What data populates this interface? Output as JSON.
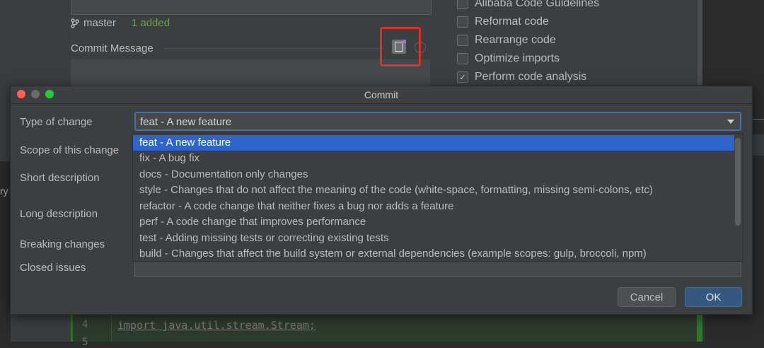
{
  "background": {
    "branch": "master",
    "added": "1 added",
    "commit_message_label": "Commit Message",
    "options": [
      {
        "label": "Alibaba Code Guidelines",
        "checked": false
      },
      {
        "label": "Reformat code",
        "checked": false
      },
      {
        "label": "Rearrange code",
        "checked": false
      },
      {
        "label": "Optimize imports",
        "checked": false
      },
      {
        "label": "Perform code analysis",
        "checked": true
      }
    ],
    "check_mark": "✓",
    "code_line_number": "4",
    "code_line_number_next": "5",
    "code_line": "import java.util.stream.Stream;",
    "left_edge_text": "ry"
  },
  "dialog": {
    "title": "Commit",
    "fields": {
      "type_of_change": "Type of change",
      "scope": "Scope of this change",
      "short_description": "Short description",
      "long_description": "Long description",
      "breaking_changes": "Breaking changes",
      "closed_issues": "Closed issues"
    },
    "selected_type": "feat - A new feature",
    "dropdown_items": [
      "feat - A new feature",
      "fix - A bug fix",
      "docs - Documentation only changes",
      "style - Changes that do not affect the meaning of the code (white-space, formatting, missing semi-colons, etc)",
      "refactor - A code change that neither fixes a bug nor adds a feature",
      "perf - A code change that improves performance",
      "test - Adding missing tests or correcting existing tests",
      "build - Changes that affect the build system or external dependencies (example scopes: gulp, broccoli, npm)"
    ],
    "cancel_label": "Cancel",
    "ok_label": "OK"
  },
  "colors": {
    "selection": "#2f65ca",
    "highlight_box": "#d9322b",
    "ok_button": "#365880",
    "added_text": "#6a9f4b"
  }
}
